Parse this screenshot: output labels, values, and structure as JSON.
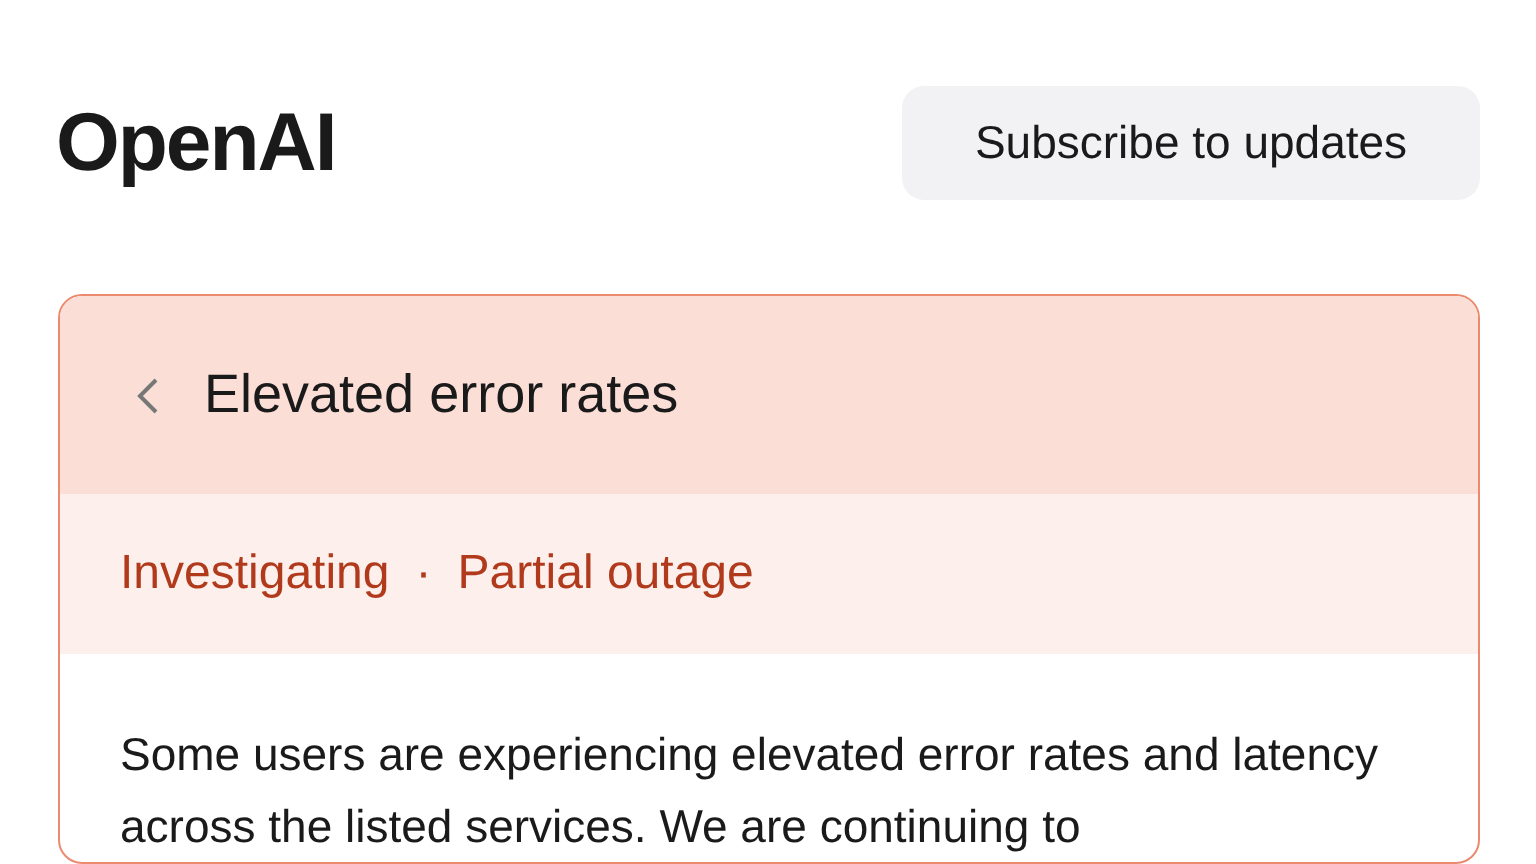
{
  "header": {
    "logo": "OpenAI",
    "subscribe_button": "Subscribe to updates"
  },
  "incident": {
    "title": "Elevated error rates",
    "status": "Investigating",
    "separator": "·",
    "impact": "Partial outage",
    "description": "Some users are experiencing elevated error rates and latency across the listed services. We are continuing to"
  }
}
